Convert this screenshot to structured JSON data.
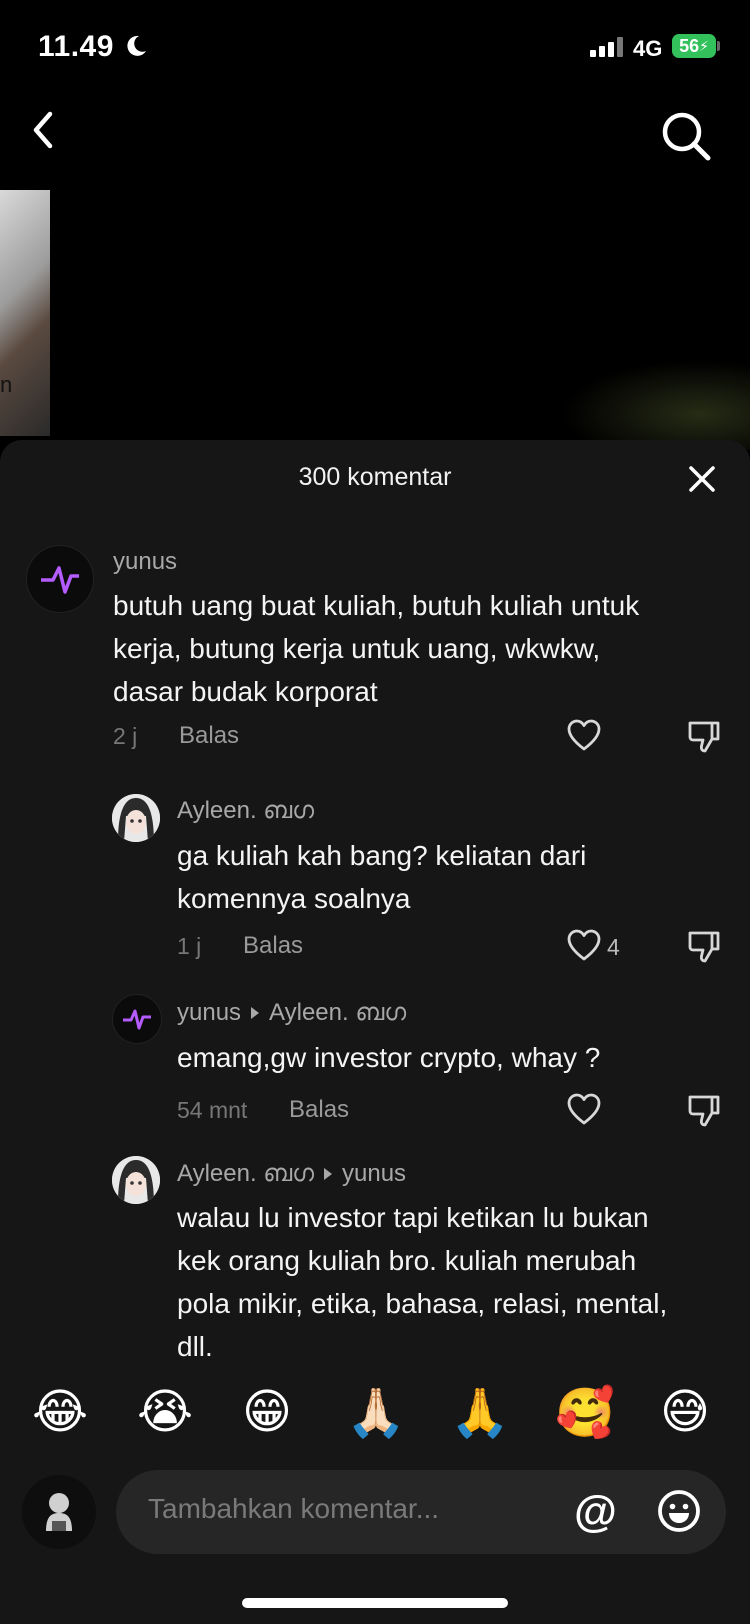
{
  "status_bar": {
    "time": "11.49",
    "network": "4G",
    "battery": "56"
  },
  "sheet": {
    "title": "300 komentar"
  },
  "comments": [
    {
      "user": "yunus",
      "text_lines": [
        "butuh uang buat kuliah, butuh kuliah untuk",
        "kerja, butung kerja untuk uang, wkwkw,",
        "dasar budak korporat"
      ],
      "time": "2 j",
      "reply": "Balas"
    },
    {
      "user": "Ayleen. ബഗ",
      "text_lines": [
        "ga kuliah kah bang? keliatan dari",
        "komennya soalnya"
      ],
      "time": "1 j",
      "reply": "Balas",
      "likes": "4"
    },
    {
      "user": "yunus",
      "reply_to": "Ayleen. ബഗ",
      "text_lines": [
        "emang,gw investor crypto, whay ?"
      ],
      "time": "54 mnt",
      "reply": "Balas"
    },
    {
      "user": "Ayleen. ബഗ",
      "reply_to": "yunus",
      "text_lines": [
        "walau lu investor tapi ketikan lu bukan",
        "kek orang kuliah bro. kuliah merubah",
        "pola mikir, etika, bahasa, relasi, mental,",
        "dll."
      ]
    }
  ],
  "emojis": [
    "😂",
    "😭",
    "😁",
    "🙏🏻",
    "🙏",
    "🥰",
    "😅"
  ],
  "input": {
    "placeholder": "Tambahkan komentar...",
    "at_symbol": "@"
  },
  "icons": [
    "moon-icon",
    "back-icon",
    "search-icon",
    "close-icon",
    "heart-icon",
    "dislike-icon",
    "emoji-icon"
  ]
}
